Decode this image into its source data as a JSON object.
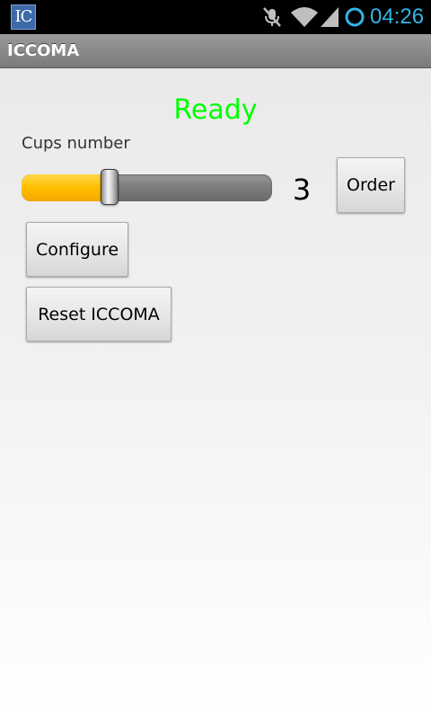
{
  "status_bar": {
    "app_notification_icon_text": "IC",
    "time": "04:26",
    "icons": [
      "muted-icon",
      "wifi-icon",
      "cell-signal-icon",
      "battery-charging-icon"
    ],
    "clock_color": "#33b5e5"
  },
  "title_bar": {
    "title": "ICCOMA"
  },
  "main": {
    "status_text": "Ready",
    "status_color": "#00ff00",
    "cups_label": "Cups number",
    "cups_slider_fraction": 0.35,
    "cups_value": "3",
    "order_button": "Order",
    "configure_button": "Configure",
    "reset_button": "Reset ICCOMA",
    "accent_color": "#ffbf00"
  }
}
